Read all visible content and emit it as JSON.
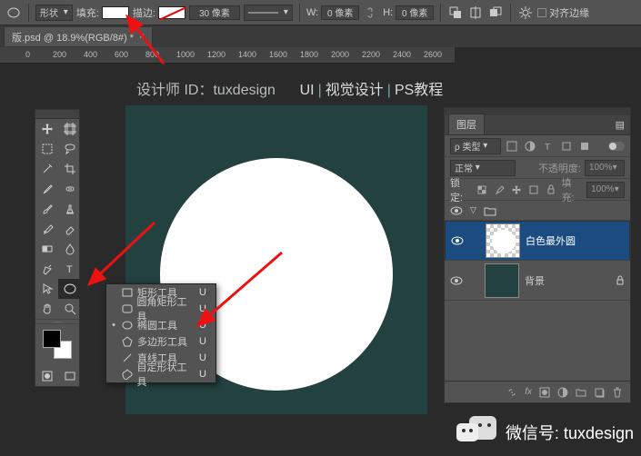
{
  "options": {
    "shapeLabel": "形状",
    "fillLabel": "填充:",
    "fillColor": "#ffffff",
    "strokeLabel": "描边:",
    "strokeNone": true,
    "strokeWidth": "30 像素",
    "wLabel": "W:",
    "wVal": "0 像素",
    "hLabel": "H:",
    "hVal": "0 像素",
    "alignEdges": "对齐边缘"
  },
  "tab": {
    "title": "版.psd @ 18.9%(RGB/8#) *"
  },
  "ruler": [
    "0",
    "200",
    "400",
    "600",
    "800",
    "1000",
    "1200",
    "1400",
    "1600",
    "1800",
    "2000",
    "2200",
    "2400",
    "2600"
  ],
  "header": {
    "left": "设计师 ID：tuxdesign",
    "p1": "UI",
    "p2": "视觉设计",
    "p3": "PS教程"
  },
  "shapeMenu": {
    "items": [
      {
        "label": "矩形工具",
        "key": "U",
        "sel": false,
        "icon": "rect"
      },
      {
        "label": "圆角矩形工具",
        "key": "U",
        "sel": false,
        "icon": "rrect"
      },
      {
        "label": "椭圆工具",
        "key": "U",
        "sel": true,
        "icon": "ellipse"
      },
      {
        "label": "多边形工具",
        "key": "U",
        "sel": false,
        "icon": "poly"
      },
      {
        "label": "直线工具",
        "key": "U",
        "sel": false,
        "icon": "line"
      },
      {
        "label": "自定形状工具",
        "key": "U",
        "sel": false,
        "icon": "custom"
      }
    ]
  },
  "layers": {
    "tab": "图层",
    "kindLabel": "ρ 类型",
    "blend": "正常",
    "opacityLabel": "不透明度:",
    "opacity": "100%",
    "lockLabel": "锁定:",
    "fillLabel": "填充:",
    "fill": "100%",
    "rows": [
      {
        "name": "白色最外圆",
        "sel": true,
        "thumb": "circle"
      },
      {
        "name": "背景",
        "sel": false,
        "thumb": "bg"
      }
    ]
  },
  "wm": {
    "label": "微信号: tuxdesign"
  }
}
